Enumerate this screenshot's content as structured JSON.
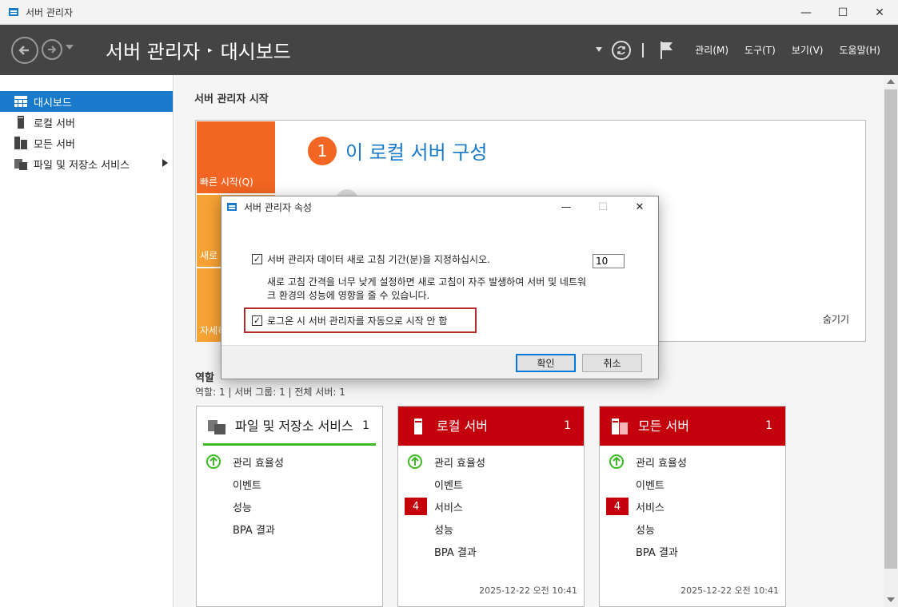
{
  "window": {
    "title": "서버 관리자",
    "minimize": "—",
    "maximize": "☐",
    "close": "✕"
  },
  "header": {
    "breadcrumb_root": "서버 관리자",
    "breadcrumb_sep": "▸",
    "breadcrumb_current": "대시보드",
    "menus": [
      "관리(M)",
      "도구(T)",
      "보기(V)",
      "도움말(H)"
    ]
  },
  "sidebar": {
    "items": [
      {
        "label": "대시보드",
        "icon": "dashboard-icon"
      },
      {
        "label": "로컬 서버",
        "icon": "server-icon"
      },
      {
        "label": "모든 서버",
        "icon": "servers-icon"
      },
      {
        "label": "파일 및 저장소 서비스",
        "icon": "storage-icon"
      }
    ]
  },
  "welcome": {
    "section_title": "서버 관리자 시작",
    "tiles": [
      "빠른 시작(Q)",
      "새로",
      "자세히"
    ],
    "step_number": "1",
    "step_title": "이 로컬 서버 구성",
    "hide": "숨기기"
  },
  "roles": {
    "title": "역할",
    "stats": "역할: 1   |   서버 그룹: 1   |   전체 서버: 1"
  },
  "cards": [
    {
      "title": "파일 및 저장소 서비스",
      "count": "1",
      "rows": [
        "관리 효율성",
        "이벤트",
        "성능",
        "BPA 결과"
      ]
    },
    {
      "title": "로컬 서버",
      "count": "1",
      "rows": [
        "관리 효율성",
        "이벤트",
        "서비스",
        "성능",
        "BPA 결과"
      ],
      "badge": "4",
      "time": "2025-12-22 오전 10:41"
    },
    {
      "title": "모든 서버",
      "count": "1",
      "rows": [
        "관리 효율성",
        "이벤트",
        "서비스",
        "성능",
        "BPA 결과"
      ],
      "badge": "4",
      "time": "2025-12-22 오전 10:41"
    }
  ],
  "dialog": {
    "title": "서버 관리자 속성",
    "refresh_label": "서버 관리자 데이터 새로 고침 기간(분)을 지정하십시오.",
    "refresh_value": "10",
    "description": "새로 고침 간격을 너무 낮게 설정하면 새로 고침이 자주 발생하여 서버 및 네트워크 환경의 성능에 영향을 줄 수 있습니다.",
    "no_autostart_label": "로그온 시 서버 관리자를 자동으로 시작 안 함",
    "ok": "확인",
    "cancel": "취소",
    "check": "✓"
  },
  "colors": {
    "accent": "#1979ca",
    "orange": "#f26522",
    "amber": "#f7a234",
    "red": "#c3000b",
    "green": "#3cba23"
  }
}
